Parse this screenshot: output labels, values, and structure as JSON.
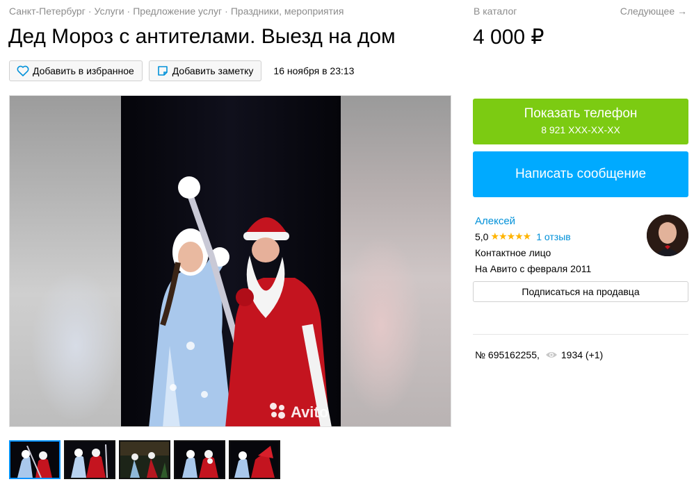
{
  "breadcrumbs": [
    "Санкт-Петербург",
    "Услуги",
    "Предложение услуг",
    "Праздники, мероприятия"
  ],
  "breadcrumb_separator": "·",
  "catalog_link": "В каталог",
  "next_link": "Следующее →",
  "title": "Дед Мороз с антителами. Выезд на дом",
  "price": "4 000 ₽",
  "actions": {
    "favorite_label": "Добавить в избранное",
    "note_label": "Добавить заметку",
    "date": "16 ноября в 23:13"
  },
  "gallery": {
    "watermark": "Avito",
    "thumbnail_count": 5,
    "active_thumbnail": 1
  },
  "contact": {
    "show_phone_label": "Показать телефон",
    "phone_masked": "8 921 XXX-XX-XX",
    "message_label": "Написать сообщение",
    "subscribe_label": "Подписаться на продавца"
  },
  "seller": {
    "name": "Алексей",
    "rating": "5,0",
    "stars": "★★★★★",
    "reviews": "1 отзыв",
    "role": "Контактное лицо",
    "since": "На Авито с февраля 2011"
  },
  "ad": {
    "number": "№ 695162255,",
    "views": "1934 (+1)"
  },
  "colors": {
    "phone_button": "#7ccb12",
    "message_button": "#00aaff",
    "link": "#0091d9",
    "star": "#ffb400",
    "muted_text": "#8c8c8c"
  },
  "icons": [
    "heart-icon",
    "note-icon",
    "eye-icon",
    "avito-logo-icon"
  ]
}
